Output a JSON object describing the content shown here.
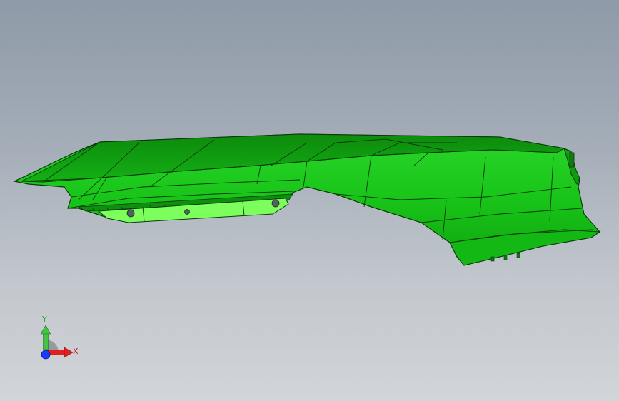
{
  "viewport": {
    "background_top": "#8f9aa8",
    "background_bottom": "#d2d5d9"
  },
  "model": {
    "part": "fender-panel",
    "color": "#19cc19",
    "bracket_color": "#7aff5a",
    "edge_color": "#0a3a0a"
  },
  "triad": {
    "y_label": "Y",
    "x_label": "X",
    "y_color": "#3cbf3c",
    "x_color": "#e02020",
    "z_color": "#1a3aff"
  }
}
